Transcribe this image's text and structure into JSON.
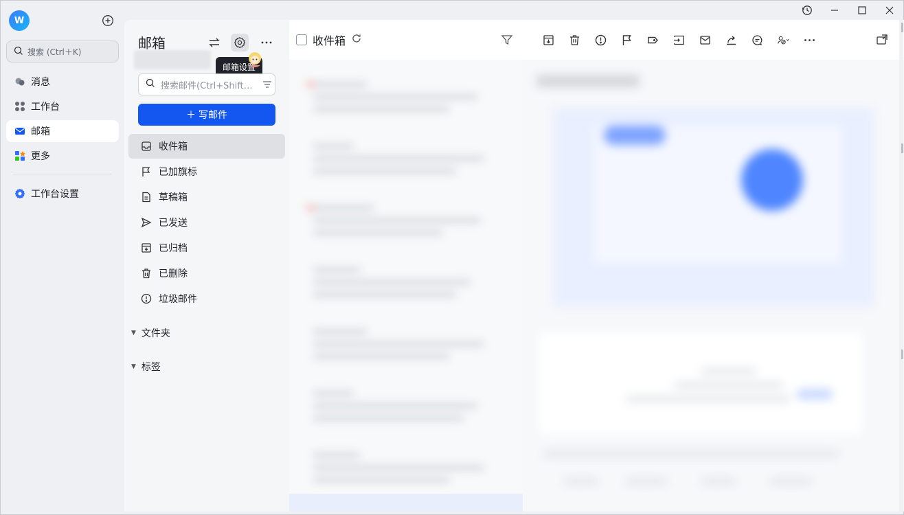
{
  "nav": {
    "avatar_initial": "W",
    "search_placeholder": "搜索 (Ctrl＋K)",
    "items": [
      {
        "label": "消息"
      },
      {
        "label": "工作台"
      },
      {
        "label": "邮箱"
      },
      {
        "label": "更多"
      }
    ],
    "settings_label": "工作台设置"
  },
  "mailbox": {
    "title": "邮箱",
    "tooltip": "邮箱设置",
    "search_placeholder": "搜索邮件(Ctrl+Shift+F)",
    "compose_label": "写邮件",
    "compose_plus": "＋",
    "folders": [
      {
        "label": "收件箱",
        "icon": "inbox-icon"
      },
      {
        "label": "已加旗标",
        "icon": "flag-icon"
      },
      {
        "label": "草稿箱",
        "icon": "draft-icon"
      },
      {
        "label": "已发送",
        "icon": "send-icon"
      },
      {
        "label": "已归档",
        "icon": "archive-icon"
      },
      {
        "label": "已删除",
        "icon": "trash-icon"
      },
      {
        "label": "垃圾邮件",
        "icon": "spam-icon"
      }
    ],
    "sections": [
      {
        "label": "文件夹"
      },
      {
        "label": "标签"
      }
    ]
  },
  "mail_list": {
    "title": "收件箱"
  },
  "colors": {
    "primary": "#1456f0",
    "active_bg": "#dee0e3",
    "sidebar_bg": "#eef0f3"
  }
}
